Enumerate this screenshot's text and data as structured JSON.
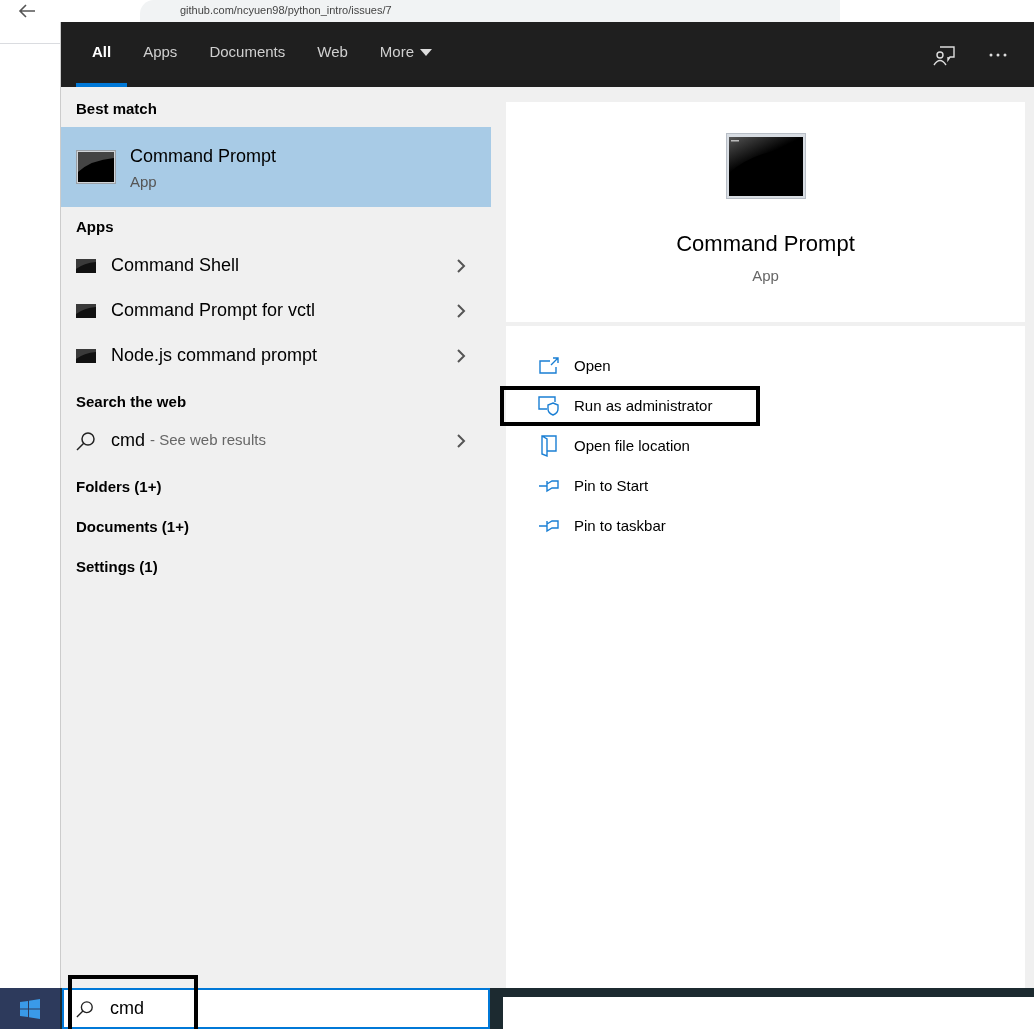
{
  "browser": {
    "url": "github.com/ncyuen98/python_intro/issues/7"
  },
  "tabs": [
    {
      "label": "All",
      "selected": true,
      "kind": "filter"
    },
    {
      "label": "Apps",
      "selected": false,
      "kind": "filter"
    },
    {
      "label": "Documents",
      "selected": false,
      "kind": "filter"
    },
    {
      "label": "Web",
      "selected": false,
      "kind": "filter"
    },
    {
      "label": "More",
      "selected": false,
      "kind": "menu"
    }
  ],
  "results": {
    "best_match_heading": "Best match",
    "best_match": {
      "title": "Command Prompt",
      "subtitle": "App",
      "selected": true
    },
    "groups": [
      {
        "heading": "Apps",
        "items": [
          {
            "kind": "app",
            "label": "Command Shell"
          },
          {
            "kind": "app",
            "label": "Command Prompt for vctl"
          },
          {
            "kind": "app",
            "label": "Node.js command prompt"
          }
        ]
      },
      {
        "heading": "Search the web",
        "items": [
          {
            "kind": "web",
            "label": "cmd",
            "hint": "- See web results"
          }
        ]
      },
      {
        "heading": "Folders (1+)"
      },
      {
        "heading": "Documents (1+)"
      },
      {
        "heading": "Settings (1)"
      }
    ]
  },
  "preview": {
    "title": "Command Prompt",
    "subtitle": "App"
  },
  "actions": [
    {
      "kind": "open",
      "label": "Open",
      "highlighted": false
    },
    {
      "kind": "admin",
      "label": "Run as administrator",
      "highlighted": true
    },
    {
      "kind": "location",
      "label": "Open file location",
      "highlighted": false
    },
    {
      "kind": "pin",
      "label": "Pin to Start",
      "highlighted": false
    },
    {
      "kind": "pin",
      "label": "Pin to taskbar",
      "highlighted": false
    }
  ],
  "taskbar": {
    "search": {
      "value": "cmd",
      "highlighted": true
    }
  }
}
